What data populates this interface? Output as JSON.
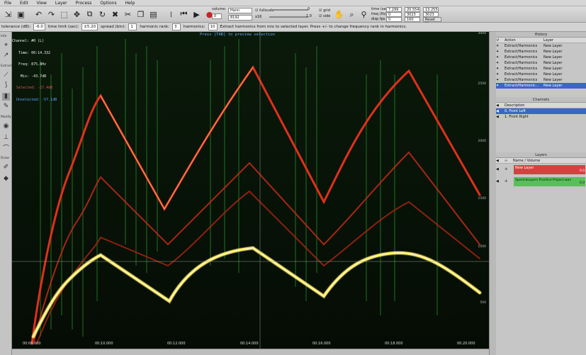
{
  "menu": [
    "File",
    "Edit",
    "View",
    "Layer",
    "Process",
    "Options",
    "Help"
  ],
  "toolbar": {
    "volume_label": "volume:",
    "volume_db": "0",
    "window_label": "Hann",
    "fft_value": "8192",
    "fft_label": "x16",
    "fullscale_label": "fullscale",
    "grid_label": "grid",
    "side_label": "side",
    "scale_value": "0",
    "scale_value2": "1.0",
    "time_label": "time (sec):",
    "time_start": "7.299",
    "time_end": "20.554",
    "time_len": "13.255",
    "freq_label": "freq (Hz):",
    "freq_start": "0",
    "freq_end": "3023",
    "freq_len": "3023",
    "disp_label": "disp fps (%):",
    "disp_value": "0",
    "disp_value2": "160",
    "reset_view": "Reset View"
  },
  "options": {
    "tolerance_label": "tolerance (dB):",
    "tolerance_value": "-6.0",
    "time_limit_label": "time limit (sec):",
    "time_limit_value": "±5.20",
    "spread_label": "spread (bin):",
    "spread_value": "1",
    "rank_label": "harmonic rank:",
    "rank_value": "3",
    "harmonics_label": "harmonics:",
    "harmonics_value": "10",
    "hint": "Extract harmonics from mix to selected layer. Press +/- to change frequency rank in harmonics."
  },
  "left_tools": {
    "sections": [
      "Info",
      "Extract",
      "Modify",
      "Draw"
    ]
  },
  "spectrogram": {
    "info_lines": [
      "Channel: #0 (L)",
      "   Time: 00:14.332",
      "   Freq: 875.8Hz",
      "    Mix: -43.7dB",
      "  Selected: -27.4dB",
      "  Unselected: -57.1dB"
    ],
    "hint": "Press [TAB] to preview selection",
    "freq_ticks": [
      "3000",
      "2500",
      "2000",
      "1500",
      "1000",
      "500"
    ],
    "time_ticks": [
      "00:08.000",
      "00:10.000",
      "00:12.000",
      "00:14.000",
      "00:16.000",
      "00:18.000",
      "00:20.000"
    ]
  },
  "history": {
    "title": "History",
    "col_action": "Action",
    "col_layer": "Layer",
    "rows": [
      {
        "action": "Extract/Harmonics",
        "layer": "New Layer"
      },
      {
        "action": "Extract/Harmonics",
        "layer": "New Layer"
      },
      {
        "action": "Extract/Harmonics",
        "layer": "New Layer"
      },
      {
        "action": "Extract/Harmonics",
        "layer": "New Layer"
      },
      {
        "action": "Extract/Harmonics",
        "layer": "New Layer"
      },
      {
        "action": "Extract/Harmonics",
        "layer": "New Layer"
      },
      {
        "action": "Extract/Harmonics",
        "layer": "New Layer"
      },
      {
        "action": "Extract/Harmonic...",
        "layer": "New Layer"
      }
    ]
  },
  "channels": {
    "title": "Channels",
    "col_desc": "Description",
    "rows": [
      "0. Front Left",
      "1. Front Right"
    ]
  },
  "layers": {
    "title": "Layers",
    "col_name": "Name / Volume",
    "rows": [
      {
        "name": "New Layer",
        "vol": "0.0"
      },
      {
        "name": "SpectraLayers Practice Project.wav",
        "vol": "0.0"
      }
    ]
  }
}
